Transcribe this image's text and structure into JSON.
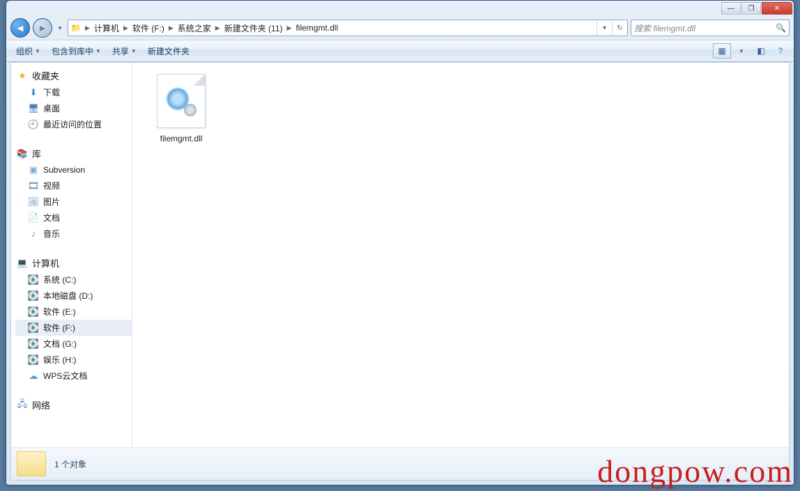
{
  "window_controls": {
    "min": "—",
    "max": "❐",
    "close": "✕"
  },
  "breadcrumbs": [
    "计算机",
    "软件 (F:)",
    "系统之家",
    "新建文件夹 (11)",
    "filemgmt.dll"
  ],
  "search": {
    "placeholder": "搜索 filemgmt.dll"
  },
  "toolbar": {
    "organize": "组织",
    "include": "包含到库中",
    "share": "共享",
    "newfolder": "新建文件夹"
  },
  "sidebar": {
    "favorites": {
      "label": "收藏夹",
      "items": [
        "下载",
        "桌面",
        "最近访问的位置"
      ]
    },
    "library": {
      "label": "库",
      "items": [
        "Subversion",
        "视频",
        "图片",
        "文档",
        "音乐"
      ]
    },
    "computer": {
      "label": "计算机",
      "items": [
        "系统 (C:)",
        "本地磁盘 (D:)",
        "软件 (E:)",
        "软件 (F:)",
        "文档 (G:)",
        "娱乐 (H:)",
        "WPS云文档"
      ],
      "selected_index": 3
    },
    "network": {
      "label": "网络"
    }
  },
  "files": [
    {
      "name": "filemgmt.dll"
    }
  ],
  "status": {
    "count_label": "1 个对象"
  },
  "watermark": "dongpow.com"
}
